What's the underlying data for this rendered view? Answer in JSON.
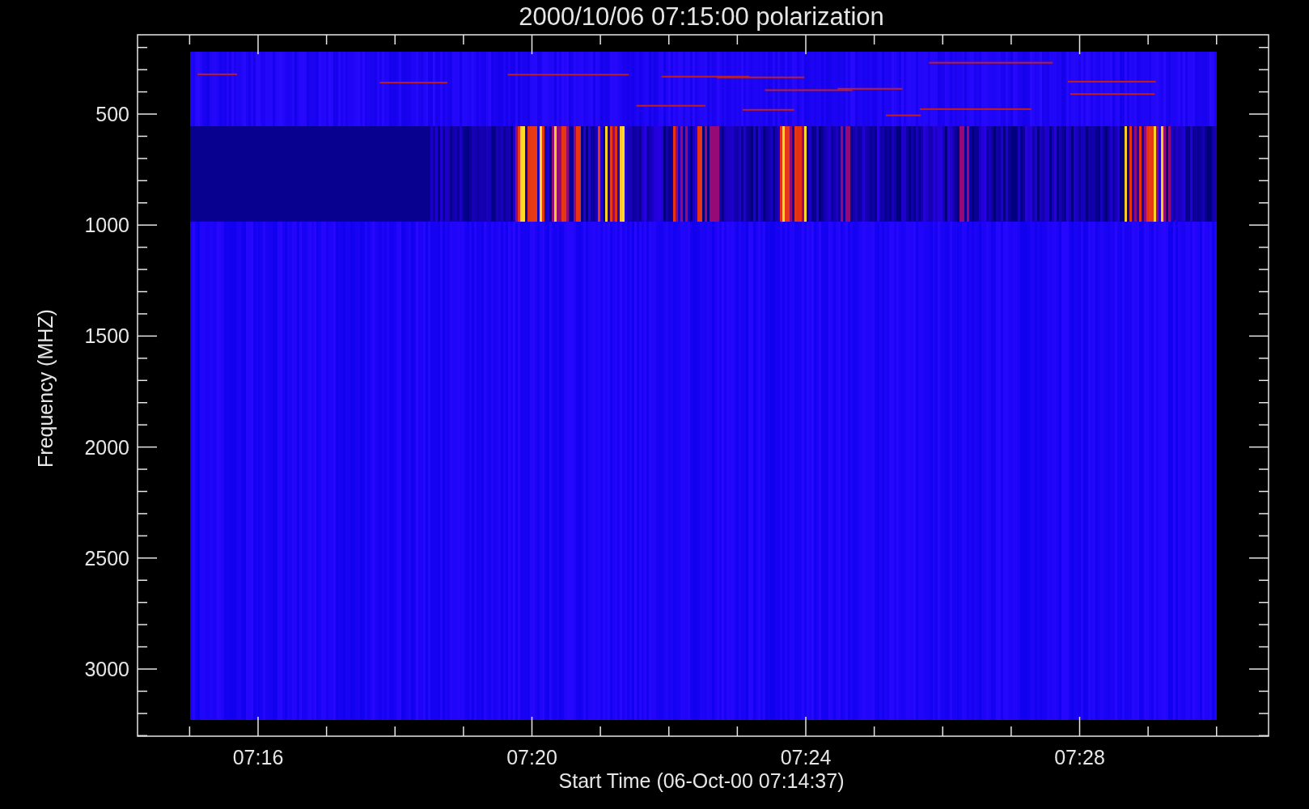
{
  "title": "2000/10/06 07:15:00 polarization",
  "y_axis": {
    "label": "Frequency (MHZ)",
    "ticks": [
      "500",
      "1000",
      "1500",
      "2000",
      "2500",
      "3000"
    ]
  },
  "x_axis": {
    "label": "Start Time (06-Oct-00 07:14:37)",
    "ticks": [
      "07:16",
      "07:20",
      "07:24",
      "07:28"
    ]
  }
}
